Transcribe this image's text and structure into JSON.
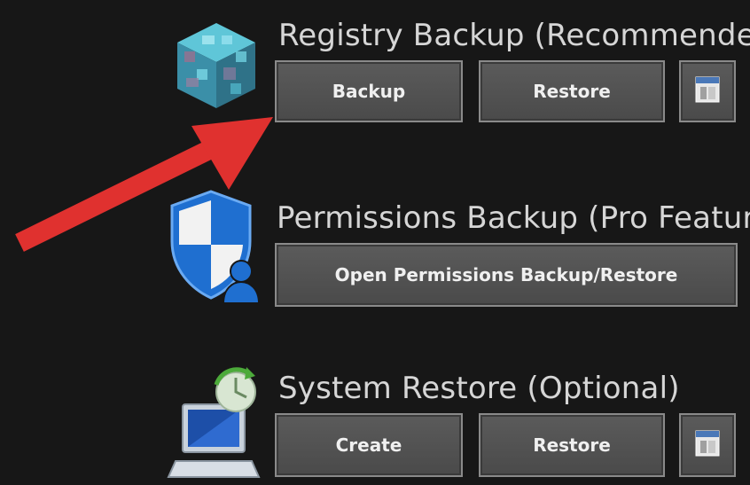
{
  "registry": {
    "title": "Registry Backup (Recommended)",
    "backup_label": "Backup",
    "restore_label": "Restore",
    "icon": "registry-cube-icon",
    "folder_icon": "folder-icon"
  },
  "permissions": {
    "title": "Permissions Backup (Pro Feature)",
    "open_label": "Open Permissions Backup/Restore",
    "icon": "shield-user-icon"
  },
  "system_restore": {
    "title": "System Restore (Optional)",
    "create_label": "Create",
    "restore_label": "Restore",
    "icon": "computer-restore-icon",
    "folder_icon": "folder-icon"
  },
  "annotation": {
    "icon": "red-arrow-icon",
    "color": "#e0312f"
  }
}
